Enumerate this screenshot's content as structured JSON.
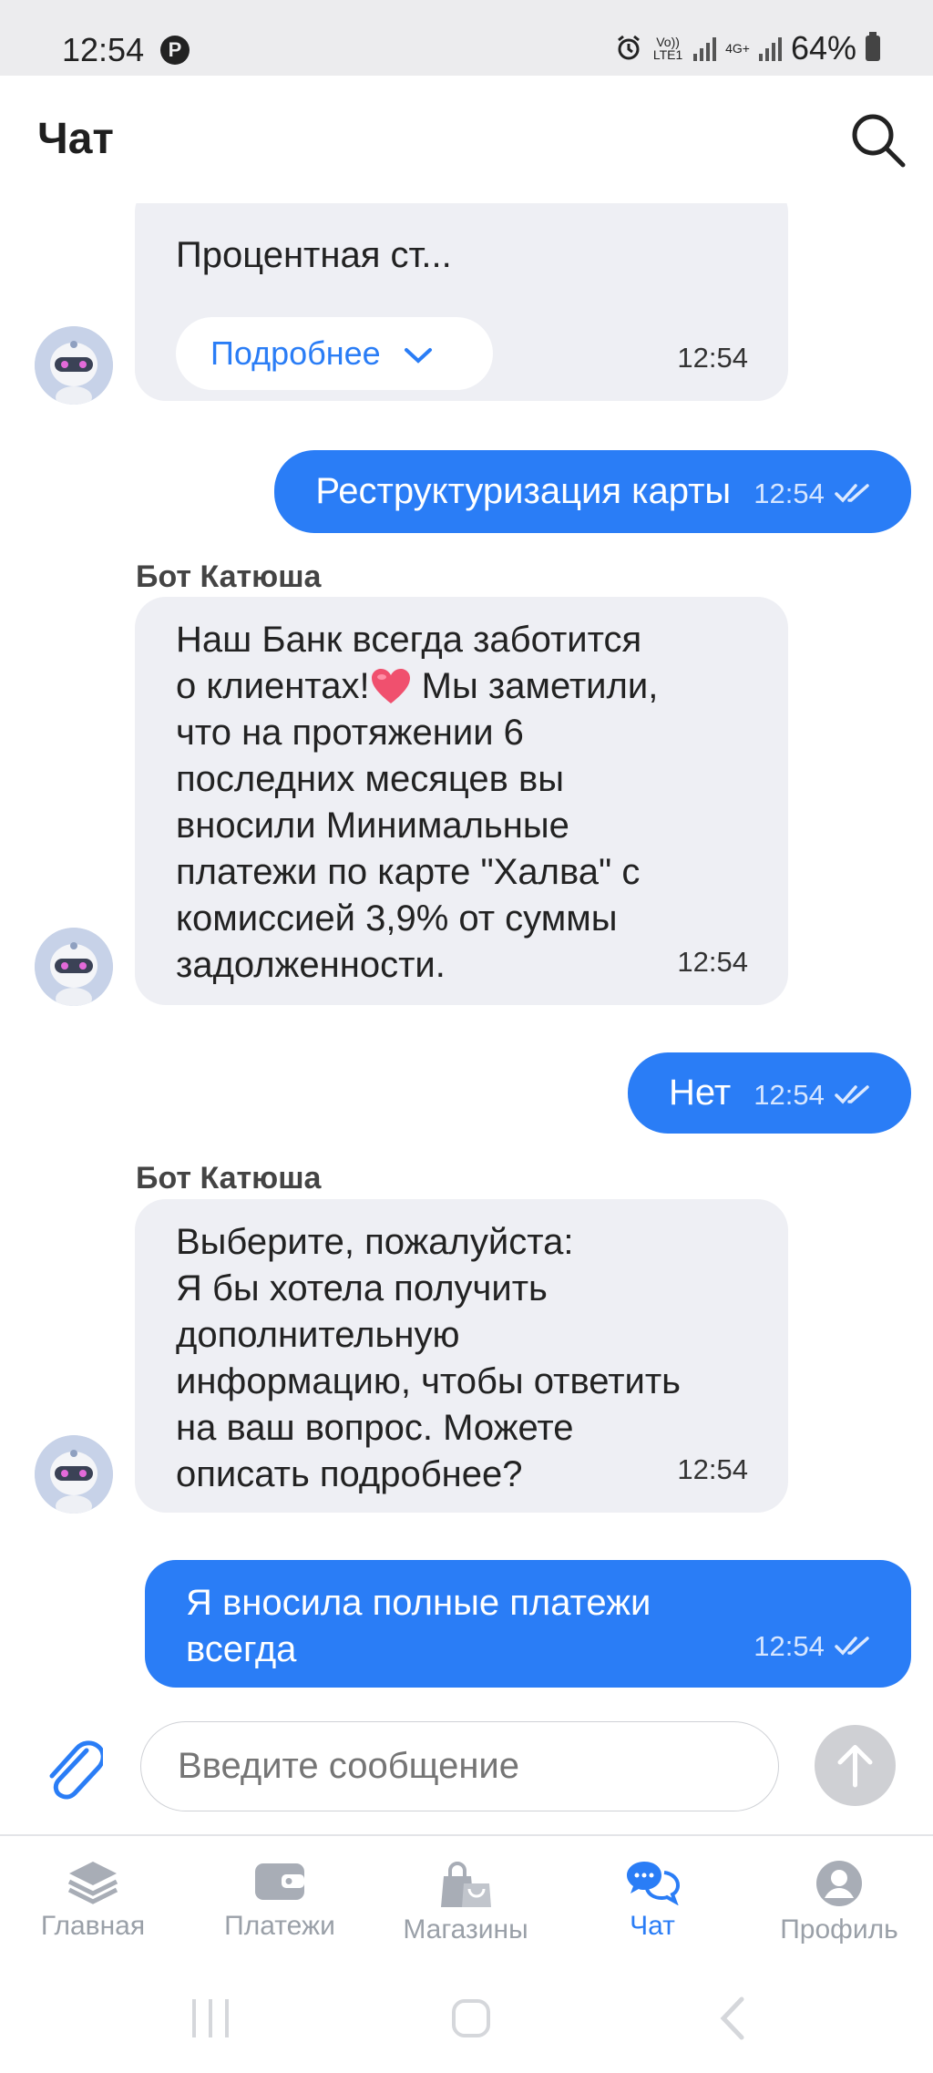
{
  "status_bar": {
    "time": "12:54",
    "volte": "Vo)) LTE1",
    "network": "4G+",
    "battery": "64%"
  },
  "header": {
    "title": "Чат"
  },
  "messages": {
    "m1": {
      "text": "Процентная ст...",
      "more_label": "Подробнее",
      "time": "12:54"
    },
    "u1": {
      "text": "Реструктуризация карты",
      "time": "12:54"
    },
    "m2": {
      "sender": "Бот Катюша",
      "lines": [
        "Наш Банк всегда заботится",
        "о клиентах!",
        " Мы заметили,",
        "что на протяжении 6",
        "последних месяцев вы",
        "вносили Минимальные",
        "платежи по карте \"Халва\" с",
        "комиссией 3,9% от суммы",
        "задолженности."
      ],
      "time": "12:54"
    },
    "u2": {
      "text": "Нет",
      "time": "12:54"
    },
    "m3": {
      "sender": "Бот Катюша",
      "lines": [
        "Выберите, пожалуйста:",
        "Я бы хотела получить",
        "дополнительную",
        "информацию, чтобы ответить",
        "на ваш вопрос. Можете",
        "описать подробнее?"
      ],
      "time": "12:54"
    },
    "u3": {
      "lines": [
        "Я вносила полные платежи",
        "всегда"
      ],
      "time": "12:54"
    }
  },
  "composer": {
    "placeholder": "Введите сообщение"
  },
  "nav": [
    {
      "label": "Главная",
      "icon": "layers-icon"
    },
    {
      "label": "Платежи",
      "icon": "wallet-icon"
    },
    {
      "label": "Магазины",
      "icon": "shopping-bags-icon"
    },
    {
      "label": "Чат",
      "icon": "chat-bubbles-icon"
    },
    {
      "label": "Профиль",
      "icon": "profile-icon"
    }
  ],
  "colors": {
    "accent": "#2a7df6",
    "bot_bubble": "#eeeff4",
    "muted": "#9aa0a8"
  }
}
